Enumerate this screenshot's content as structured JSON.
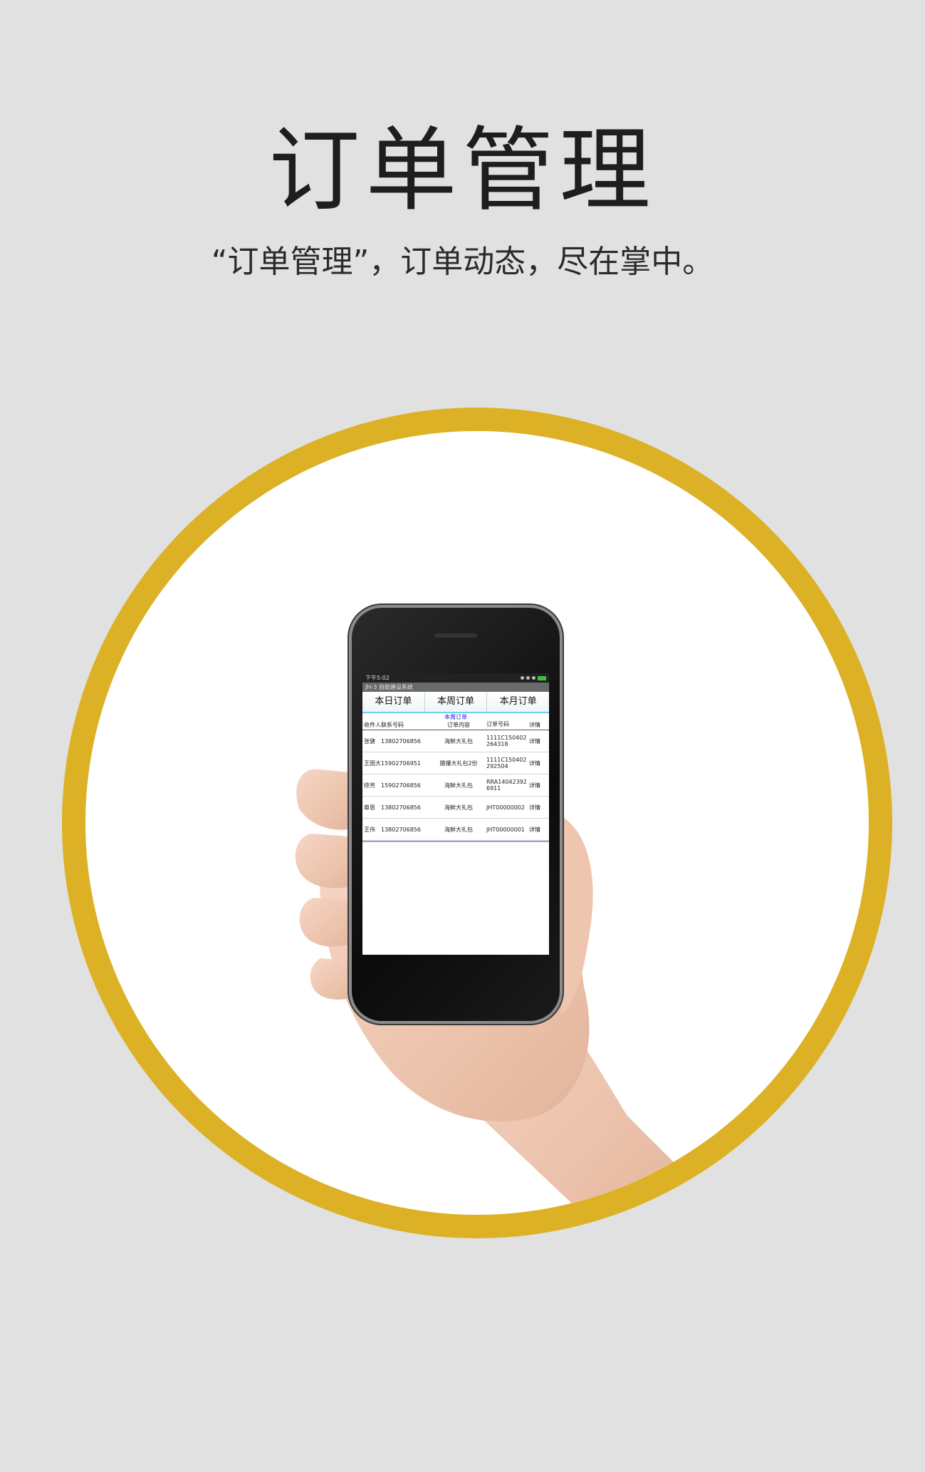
{
  "header": {
    "title": "订单管理",
    "subtitle": "“订单管理”，订单动态，尽在掌中。"
  },
  "colors": {
    "background": "#e1e1e1",
    "ring": "#dcb126",
    "circle": "#ffffff"
  },
  "phone_screen": {
    "status_time": "下午5:02",
    "app_title": "JH-3 自助建设系统",
    "tabs": [
      "本日订单",
      "本周订单",
      "本月订单"
    ],
    "table_caption": "本周订单",
    "columns": [
      "收件人",
      "联系号码",
      "订单内容",
      "订单号码",
      "详情"
    ],
    "rows": [
      {
        "name": "张健",
        "phone": "13802706856",
        "content": "海鲜大礼包",
        "order": "1111C150402264318",
        "detail": "详情"
      },
      {
        "name": "王国大",
        "phone": "15902706951",
        "content": "腊爆大礼包2份",
        "order": "1111C150402292504",
        "detail": "详情"
      },
      {
        "name": "徐芳",
        "phone": "15902706856",
        "content": "海鲜大礼包",
        "order": "RRA140423926911",
        "detail": "详情"
      },
      {
        "name": "章恩",
        "phone": "13802706856",
        "content": "海鲜大礼包",
        "order": "JHT00000002",
        "detail": "详情"
      },
      {
        "name": "王伟",
        "phone": "13802706856",
        "content": "海鲜大礼包",
        "order": "JHT00000001",
        "detail": "详情"
      }
    ]
  }
}
